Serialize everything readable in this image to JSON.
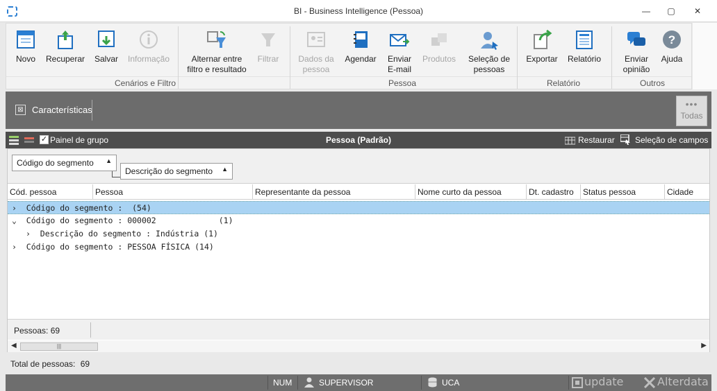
{
  "window": {
    "title": "BI - Business Intelligence (Pessoa)"
  },
  "ribbon": {
    "buttons": [
      {
        "label": "Novo",
        "icon": "new-document-icon",
        "enabled": true
      },
      {
        "label": "Recuperar",
        "icon": "recover-icon",
        "enabled": true
      },
      {
        "label": "Salvar",
        "icon": "save-icon",
        "enabled": true
      },
      {
        "label": "Informação",
        "icon": "info-icon",
        "enabled": false
      },
      {
        "label": "Alternar entre filtro e resultado",
        "line1": "Alternar entre",
        "line2": "filtro e resultado",
        "icon": "toggle-filter-icon",
        "enabled": true
      },
      {
        "label": "Filtrar",
        "icon": "filter-icon",
        "enabled": false
      },
      {
        "label": "Dados da pessoa",
        "line1": "Dados da",
        "line2": "pessoa",
        "icon": "person-card-icon",
        "enabled": false
      },
      {
        "label": "Agendar",
        "icon": "calendar-book-icon",
        "enabled": true
      },
      {
        "label": "Enviar E-mail",
        "line1": "Enviar",
        "line2": "E-mail",
        "icon": "email-icon",
        "enabled": true
      },
      {
        "label": "Produtos",
        "icon": "products-icon",
        "enabled": false
      },
      {
        "label": "Seleção de pessoas",
        "line1": "Seleção de",
        "line2": "pessoas",
        "icon": "person-select-icon",
        "enabled": true
      },
      {
        "label": "Exportar",
        "icon": "export-icon",
        "enabled": true
      },
      {
        "label": "Relatório",
        "icon": "report-icon",
        "enabled": true
      },
      {
        "label": "Enviar opinião",
        "line1": "Enviar",
        "line2": "opinião",
        "icon": "feedback-icon",
        "enabled": true
      },
      {
        "label": "Ajuda",
        "icon": "help-icon",
        "enabled": true
      }
    ],
    "groups": [
      "Cenários e Filtro",
      "Pessoa",
      "Relatório",
      "Outros"
    ]
  },
  "characteristics": {
    "label": "Características",
    "all_label": "Todas"
  },
  "grid": {
    "toolbar": {
      "group_panel_label": "Painel de grupo",
      "title": "Pessoa (Padrão)",
      "restore_label": "Restaurar",
      "field_selection_label": "Seleção de campos"
    },
    "group_chips": [
      "Código do segmento",
      "Descrição do segmento"
    ],
    "columns": [
      "Cód. pessoa",
      "Pessoa",
      "Representante da pessoa",
      "Nome curto da pessoa",
      "Dt. cadastro",
      "Status pessoa",
      "Cidade"
    ],
    "rows": [
      {
        "expander": "›",
        "text": "Código do segmento :  (54)",
        "selected": true
      },
      {
        "expander": "⌄",
        "text": "Código do segmento : 000002             (1)",
        "selected": false
      },
      {
        "expander": "›",
        "text": "Descrição do segmento : Indústria (1)",
        "selected": false
      },
      {
        "expander": "›",
        "text": "Código do segmento : PESSOA FÍSICA (14)",
        "selected": false
      }
    ],
    "footer_count": "Pessoas: 69"
  },
  "total": {
    "label": "Total de pessoas:",
    "value": "69"
  },
  "statusbar": {
    "num": "NUM",
    "user": "SUPERVISOR",
    "db": "UCA",
    "brand1": "update",
    "brand2": "Alterdata"
  },
  "colors": {
    "accent": "#2b7fd3",
    "selection": "#a9d3f3",
    "dark_bar": "#4d4d4d"
  }
}
